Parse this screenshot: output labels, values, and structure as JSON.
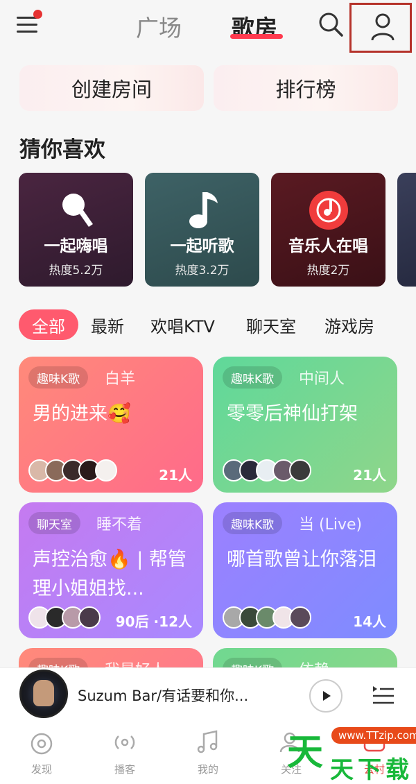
{
  "header": {
    "tabs": [
      "广场",
      "歌房"
    ],
    "active_tab": "歌房",
    "accent_color": "#ff3a4f",
    "has_notification_dot": true
  },
  "quick_actions": [
    "创建房间",
    "排行榜"
  ],
  "recommend": {
    "title": "猜你喜欢",
    "cards": [
      {
        "title": "一起嗨唱",
        "heat": "热度5.2万",
        "icon": "microphone-icon"
      },
      {
        "title": "一起听歌",
        "heat": "热度3.2万",
        "icon": "music-note-icon"
      },
      {
        "title": "音乐人在唱",
        "heat": "热度2万",
        "icon": "music-disc-icon"
      }
    ]
  },
  "categories": [
    "全部",
    "最新",
    "欢唱KTV",
    "聊天室",
    "游戏房"
  ],
  "active_category": "全部",
  "rooms": [
    {
      "badge": "趣味K歌",
      "host": "白羊",
      "title": "男的进来🥰",
      "count": "21人"
    },
    {
      "badge": "趣味K歌",
      "host": "中间人",
      "title": "零零后神仙打架",
      "count": "21人"
    },
    {
      "badge": "聊天室",
      "host": "睡不着",
      "title": "声控治愈🔥 | 帮管理小姐姐找...",
      "count": "90后 ·12人"
    },
    {
      "badge": "趣味K歌",
      "host": "当 (Live)",
      "title": "哪首歌曾让你落泪",
      "count": "14人"
    },
    {
      "badge": "趣味K歌",
      "host": "我是好人",
      "title": "",
      "count": ""
    },
    {
      "badge": "趣味K歌",
      "host": "依赖",
      "title": "",
      "count": ""
    }
  ],
  "player": {
    "song": "Suzum Bar/有话要和你..."
  },
  "bottom_nav": [
    {
      "label": "发现",
      "icon": "discover-icon"
    },
    {
      "label": "播客",
      "icon": "podcast-icon"
    },
    {
      "label": "我的",
      "icon": "music-icon"
    },
    {
      "label": "关注",
      "icon": "follow-icon"
    },
    {
      "label": "云村",
      "icon": "community-icon"
    }
  ],
  "watermark": {
    "url": "www.TTzip.com",
    "chars": [
      "天",
      "天",
      "下",
      "载"
    ]
  }
}
